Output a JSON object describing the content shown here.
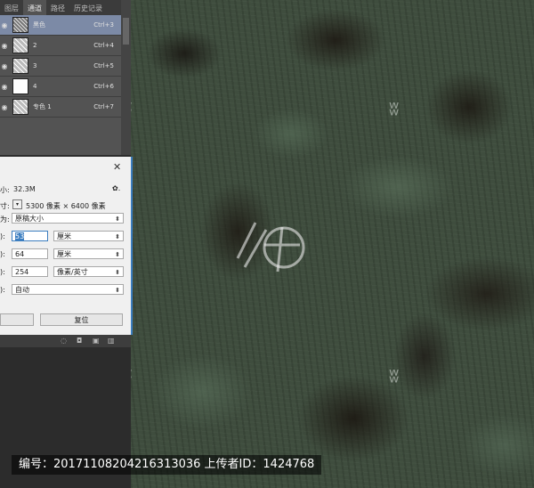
{
  "panel": {
    "tabs": [
      "图层",
      "通道",
      "路径",
      "历史记录"
    ],
    "active_tab": 1,
    "rows": [
      {
        "name": "黑色",
        "key": "Ctrl+3"
      },
      {
        "name": "2",
        "key": "Ctrl+4"
      },
      {
        "name": "3",
        "key": "Ctrl+5"
      },
      {
        "name": "4",
        "key": "Ctrl+6"
      },
      {
        "name": "专色 1",
        "key": "Ctrl+7"
      }
    ],
    "eye_glyph": "◉"
  },
  "dialog": {
    "close": "✕",
    "size_label": "小:",
    "size_value": "32.3M",
    "gear": "✿.",
    "dims_label": "寸:",
    "dims_value": "5300 像素 × 6400 像素",
    "fit_label": "为:",
    "fit_value": "原稿大小",
    "width_label": "):",
    "width_value": "53",
    "width_unit": "厘米",
    "height_label": "):",
    "height_value": "64",
    "height_unit": "厘米",
    "res_label": "):",
    "res_value": "254",
    "res_unit": "像素/英寸",
    "resample_label": "):",
    "resample_value": "自动",
    "ok_label": "",
    "reset_label": "复位"
  },
  "watermark": {
    "glyph": "ʬ"
  },
  "footer": {
    "text": "编号：20171108204216313036 上传者ID：1424768"
  }
}
